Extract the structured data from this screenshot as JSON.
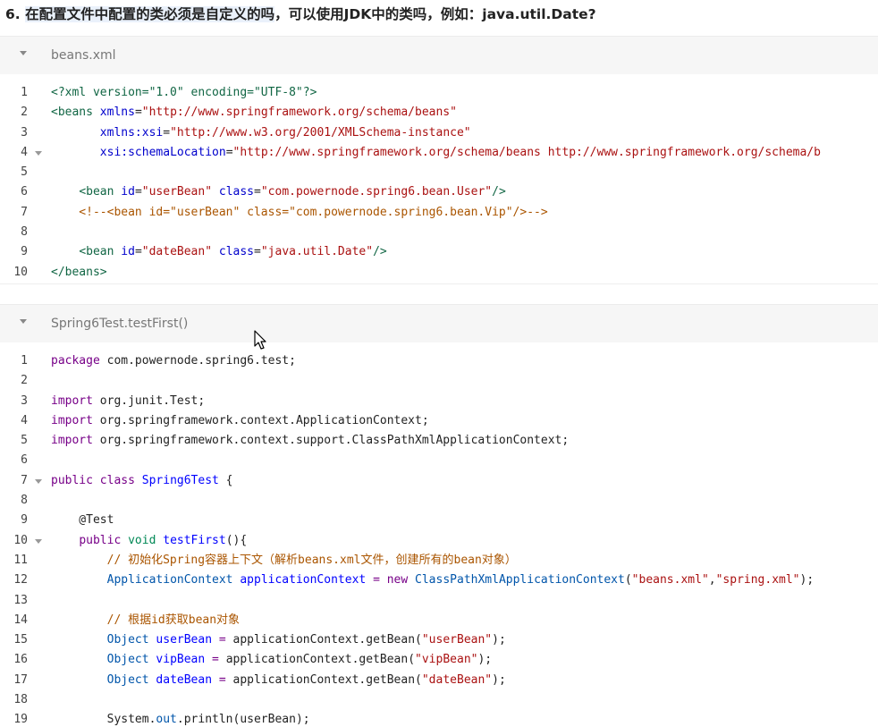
{
  "heading": {
    "number": "6.",
    "text_highlighted": "在配置文件中配置的类必须是自定义的吗",
    "text_rest": "，可以使用JDK中的类吗，例如：java.util.Date?"
  },
  "blocks": [
    {
      "title": "beans.xml",
      "lines": [
        {
          "n": "1",
          "fold": false,
          "tokens": [
            {
              "t": "<?xml version=\"1.0\" encoding=\"UTF-8\"?>",
              "c": "tag"
            }
          ]
        },
        {
          "n": "2",
          "fold": false,
          "tokens": [
            {
              "t": "<beans ",
              "c": "tag"
            },
            {
              "t": "xmlns",
              "c": "attr"
            },
            {
              "t": "=",
              "c": "plain"
            },
            {
              "t": "\"http://www.springframework.org/schema/beans\"",
              "c": "str"
            }
          ]
        },
        {
          "n": "3",
          "fold": false,
          "tokens": [
            {
              "t": "       ",
              "c": "plain"
            },
            {
              "t": "xmlns:xsi",
              "c": "attr"
            },
            {
              "t": "=",
              "c": "plain"
            },
            {
              "t": "\"http://www.w3.org/2001/XMLSchema-instance\"",
              "c": "str"
            }
          ]
        },
        {
          "n": "4",
          "fold": true,
          "tokens": [
            {
              "t": "       ",
              "c": "plain"
            },
            {
              "t": "xsi:schemaLocation",
              "c": "attr"
            },
            {
              "t": "=",
              "c": "plain"
            },
            {
              "t": "\"http://www.springframework.org/schema/beans http://www.springframework.org/schema/b",
              "c": "str"
            }
          ]
        },
        {
          "n": "5",
          "fold": false,
          "tokens": []
        },
        {
          "n": "6",
          "fold": false,
          "tokens": [
            {
              "t": "    ",
              "c": "plain"
            },
            {
              "t": "<bean ",
              "c": "tag"
            },
            {
              "t": "id",
              "c": "attr"
            },
            {
              "t": "=",
              "c": "plain"
            },
            {
              "t": "\"userBean\"",
              "c": "str"
            },
            {
              "t": " ",
              "c": "plain"
            },
            {
              "t": "class",
              "c": "attr"
            },
            {
              "t": "=",
              "c": "plain"
            },
            {
              "t": "\"com.powernode.spring6.bean.User\"",
              "c": "str"
            },
            {
              "t": "/>",
              "c": "tag"
            }
          ]
        },
        {
          "n": "7",
          "fold": false,
          "tokens": [
            {
              "t": "    <!--<bean id=\"userBean\" class=\"com.powernode.spring6.bean.Vip\"/>-->",
              "c": "comment"
            }
          ]
        },
        {
          "n": "8",
          "fold": false,
          "tokens": []
        },
        {
          "n": "9",
          "fold": false,
          "tokens": [
            {
              "t": "    ",
              "c": "plain"
            },
            {
              "t": "<bean ",
              "c": "tag"
            },
            {
              "t": "id",
              "c": "attr"
            },
            {
              "t": "=",
              "c": "plain"
            },
            {
              "t": "\"dateBean\"",
              "c": "str"
            },
            {
              "t": " ",
              "c": "plain"
            },
            {
              "t": "class",
              "c": "attr"
            },
            {
              "t": "=",
              "c": "plain"
            },
            {
              "t": "\"java.util.Date\"",
              "c": "str"
            },
            {
              "t": "/>",
              "c": "tag"
            }
          ]
        },
        {
          "n": "10",
          "fold": false,
          "tokens": [
            {
              "t": "</beans>",
              "c": "tag"
            }
          ]
        }
      ]
    },
    {
      "title": "Spring6Test.testFirst()",
      "lines": [
        {
          "n": "1",
          "fold": false,
          "tokens": [
            {
              "t": "package",
              "c": "kw"
            },
            {
              "t": " com.powernode.spring6.test;",
              "c": "plain"
            }
          ]
        },
        {
          "n": "2",
          "fold": false,
          "tokens": []
        },
        {
          "n": "3",
          "fold": false,
          "tokens": [
            {
              "t": "import",
              "c": "kw"
            },
            {
              "t": " org.junit.Test;",
              "c": "plain"
            }
          ]
        },
        {
          "n": "4",
          "fold": false,
          "tokens": [
            {
              "t": "import",
              "c": "kw"
            },
            {
              "t": " org.springframework.context.ApplicationContext;",
              "c": "plain"
            }
          ]
        },
        {
          "n": "5",
          "fold": false,
          "tokens": [
            {
              "t": "import",
              "c": "kw"
            },
            {
              "t": " org.springframework.context.support.ClassPathXmlApplicationContext;",
              "c": "plain"
            }
          ]
        },
        {
          "n": "6",
          "fold": false,
          "tokens": []
        },
        {
          "n": "7",
          "fold": true,
          "tokens": [
            {
              "t": "public",
              "c": "kw"
            },
            {
              "t": " ",
              "c": "plain"
            },
            {
              "t": "class",
              "c": "kw"
            },
            {
              "t": " ",
              "c": "plain"
            },
            {
              "t": "Spring6Test",
              "c": "def"
            },
            {
              "t": " {",
              "c": "plain"
            }
          ]
        },
        {
          "n": "8",
          "fold": false,
          "tokens": []
        },
        {
          "n": "9",
          "fold": false,
          "tokens": [
            {
              "t": "    @Test",
              "c": "plain"
            }
          ]
        },
        {
          "n": "10",
          "fold": true,
          "tokens": [
            {
              "t": "    ",
              "c": "plain"
            },
            {
              "t": "public",
              "c": "kw"
            },
            {
              "t": " ",
              "c": "plain"
            },
            {
              "t": "void",
              "c": "type"
            },
            {
              "t": " ",
              "c": "plain"
            },
            {
              "t": "testFirst",
              "c": "def"
            },
            {
              "t": "(){",
              "c": "plain"
            }
          ]
        },
        {
          "n": "11",
          "fold": false,
          "tokens": [
            {
              "t": "        // 初始化Spring容器上下文（解析beans.xml文件，创建所有的bean对象）",
              "c": "comment"
            }
          ]
        },
        {
          "n": "12",
          "fold": false,
          "tokens": [
            {
              "t": "        ",
              "c": "plain"
            },
            {
              "t": "ApplicationContext",
              "c": "var"
            },
            {
              "t": " ",
              "c": "plain"
            },
            {
              "t": "applicationContext",
              "c": "def"
            },
            {
              "t": " ",
              "c": "plain"
            },
            {
              "t": "=",
              "c": "kw"
            },
            {
              "t": " ",
              "c": "plain"
            },
            {
              "t": "new",
              "c": "kw"
            },
            {
              "t": " ",
              "c": "plain"
            },
            {
              "t": "ClassPathXmlApplicationContext",
              "c": "var"
            },
            {
              "t": "(",
              "c": "plain"
            },
            {
              "t": "\"beans.xml\"",
              "c": "str"
            },
            {
              "t": ",",
              "c": "plain"
            },
            {
              "t": "\"spring.xml\"",
              "c": "str"
            },
            {
              "t": ");",
              "c": "plain"
            }
          ]
        },
        {
          "n": "13",
          "fold": false,
          "tokens": []
        },
        {
          "n": "14",
          "fold": false,
          "tokens": [
            {
              "t": "        // 根据id获取bean对象",
              "c": "comment"
            }
          ]
        },
        {
          "n": "15",
          "fold": false,
          "tokens": [
            {
              "t": "        ",
              "c": "plain"
            },
            {
              "t": "Object",
              "c": "var"
            },
            {
              "t": " ",
              "c": "plain"
            },
            {
              "t": "userBean",
              "c": "def"
            },
            {
              "t": " ",
              "c": "plain"
            },
            {
              "t": "=",
              "c": "kw"
            },
            {
              "t": " applicationContext.getBean(",
              "c": "plain"
            },
            {
              "t": "\"userBean\"",
              "c": "str"
            },
            {
              "t": ");",
              "c": "plain"
            }
          ]
        },
        {
          "n": "16",
          "fold": false,
          "tokens": [
            {
              "t": "        ",
              "c": "plain"
            },
            {
              "t": "Object",
              "c": "var"
            },
            {
              "t": " ",
              "c": "plain"
            },
            {
              "t": "vipBean",
              "c": "def"
            },
            {
              "t": " ",
              "c": "plain"
            },
            {
              "t": "=",
              "c": "kw"
            },
            {
              "t": " applicationContext.getBean(",
              "c": "plain"
            },
            {
              "t": "\"vipBean\"",
              "c": "str"
            },
            {
              "t": ");",
              "c": "plain"
            }
          ]
        },
        {
          "n": "17",
          "fold": false,
          "tokens": [
            {
              "t": "        ",
              "c": "plain"
            },
            {
              "t": "Object",
              "c": "var"
            },
            {
              "t": " ",
              "c": "plain"
            },
            {
              "t": "dateBean",
              "c": "def"
            },
            {
              "t": " ",
              "c": "plain"
            },
            {
              "t": "=",
              "c": "kw"
            },
            {
              "t": " applicationContext.getBean(",
              "c": "plain"
            },
            {
              "t": "\"dateBean\"",
              "c": "str"
            },
            {
              "t": ");",
              "c": "plain"
            }
          ]
        },
        {
          "n": "18",
          "fold": false,
          "tokens": []
        },
        {
          "n": "19",
          "fold": false,
          "tokens": [
            {
              "t": "        System.",
              "c": "plain"
            },
            {
              "t": "out",
              "c": "var"
            },
            {
              "t": ".println(userBean);",
              "c": "plain"
            }
          ]
        }
      ]
    }
  ],
  "colors": {
    "tag": "#116644",
    "attr": "#0000cc",
    "string": "#aa1111",
    "comment": "#aa5500",
    "keyword": "#770088",
    "definition": "#0000ff",
    "variable": "#0055aa"
  }
}
